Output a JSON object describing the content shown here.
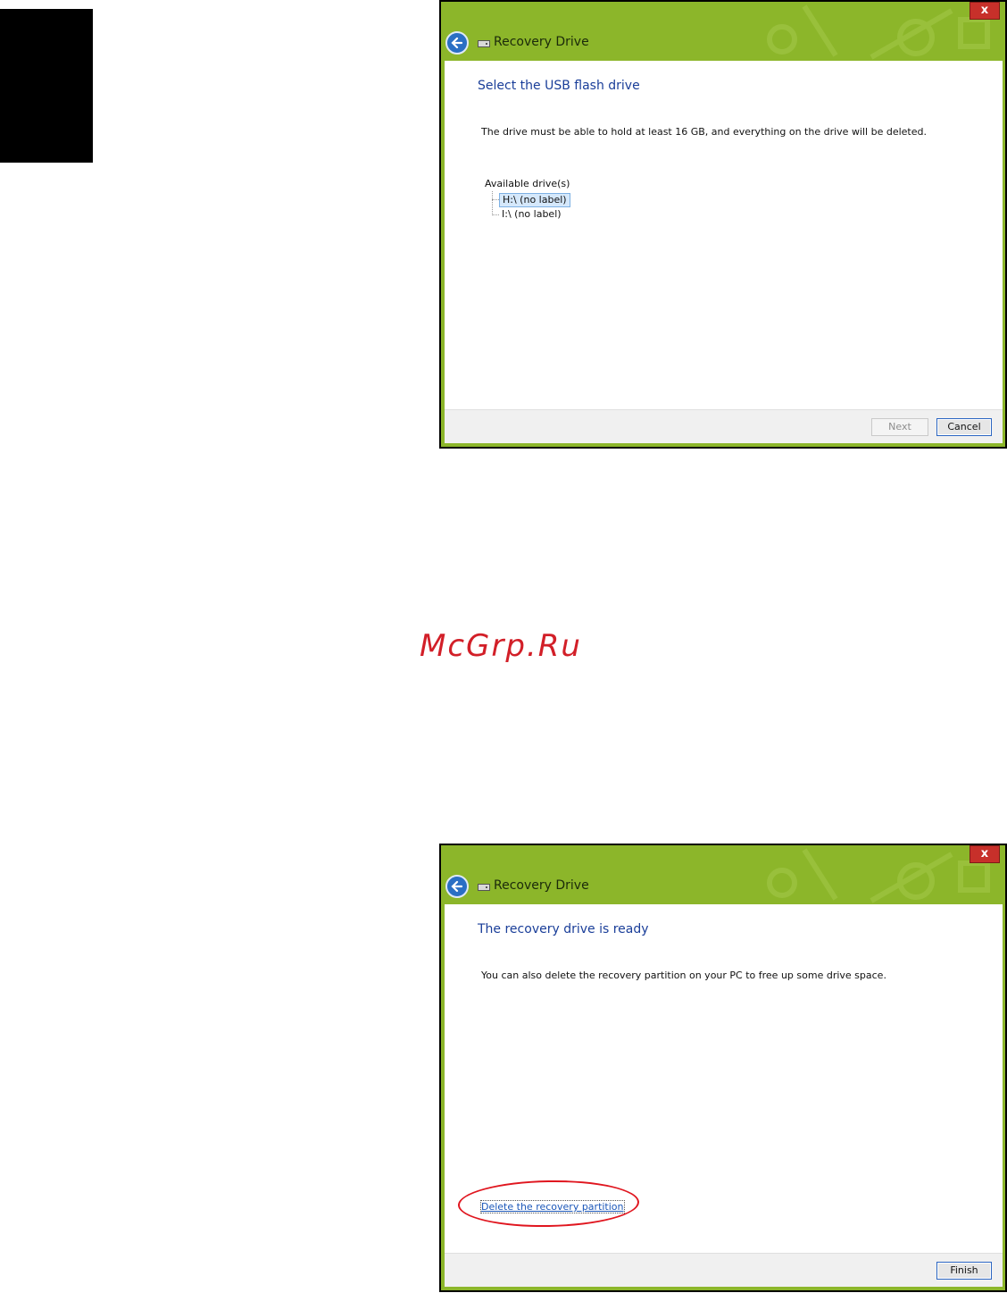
{
  "windows": [
    {
      "title": "Recovery Drive",
      "close_glyph": "x",
      "heading": "Select the USB flash drive",
      "description": "The drive must be able to hold at least 16 GB, and everything on the drive will be deleted.",
      "tree": {
        "header": "Available drive(s)",
        "items": [
          {
            "label": "H:\\ (no label)",
            "selected": true
          },
          {
            "label": "I:\\ (no label)",
            "selected": false
          }
        ]
      },
      "buttons": {
        "next": "Next",
        "cancel": "Cancel"
      }
    },
    {
      "title": "Recovery Drive",
      "close_glyph": "x",
      "heading": "The recovery drive is ready",
      "description": "You can also delete the recovery partition on your PC to free up some drive space.",
      "link": "Delete the recovery partition",
      "buttons": {
        "finish": "Finish"
      }
    }
  ],
  "watermark": "McGrp.Ru",
  "colors": {
    "titlebar": "#8cb62a",
    "close": "#c7302a",
    "heading": "#1a3e99",
    "link": "#1a56b8",
    "annotation": "#e0161f",
    "watermark": "#d21f28"
  },
  "icons": [
    "back-arrow-icon",
    "drive-icon",
    "close-icon"
  ]
}
